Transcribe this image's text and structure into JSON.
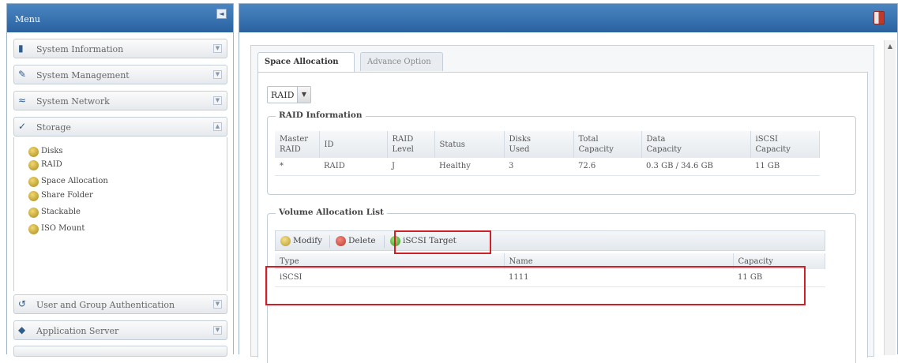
{
  "menu": {
    "title": "Menu",
    "collapse_icon": "collapse-icon",
    "items": [
      {
        "label": "System Information",
        "icon": "info-icon"
      },
      {
        "label": "System Management",
        "icon": "wrench-icon"
      },
      {
        "label": "System Network",
        "icon": "network-icon"
      },
      {
        "label": "Storage",
        "icon": "storage-icon"
      },
      {
        "label": "User and Group Authentication",
        "icon": "users-icon"
      },
      {
        "label": "Application Server",
        "icon": "server-icon"
      }
    ],
    "storage_subitems": [
      {
        "label": "Disks"
      },
      {
        "label": "RAID"
      },
      {
        "label": "Space Allocation"
      },
      {
        "label": "Share Folder"
      },
      {
        "label": "Stackable"
      },
      {
        "label": "ISO Mount"
      }
    ]
  },
  "tabs": [
    {
      "label": "Space Allocation",
      "active": true
    },
    {
      "label": "Advance Option",
      "active": false
    }
  ],
  "raid_select": {
    "value": "RAID"
  },
  "raid_info": {
    "legend": "RAID Information",
    "headers": [
      [
        "Master",
        "RAID"
      ],
      [
        "ID"
      ],
      [
        "RAID",
        "Level"
      ],
      [
        "Status"
      ],
      [
        "Disks",
        "Used"
      ],
      [
        "Total",
        "Capacity"
      ],
      [
        "Data",
        "Capacity"
      ],
      [
        "iSCSI",
        "Capacity"
      ]
    ],
    "rows": [
      [
        "*",
        "RAID",
        "J",
        "Healthy",
        "3",
        "72.6",
        "0.3 GB / 34.6 GB",
        "11 GB"
      ]
    ]
  },
  "volume_list": {
    "legend": "Volume Allocation List",
    "toolbar": {
      "modify_label": "Modify",
      "delete_label": "Delete",
      "iscsi_label": "iSCSI Target"
    },
    "headers": [
      "Type",
      "Name",
      "Capacity"
    ],
    "rows": [
      [
        "iSCSI",
        "1111",
        "11 GB"
      ]
    ]
  },
  "colors": {
    "header_blue": "#2a62a0",
    "highlight_red": "#d01f25"
  }
}
